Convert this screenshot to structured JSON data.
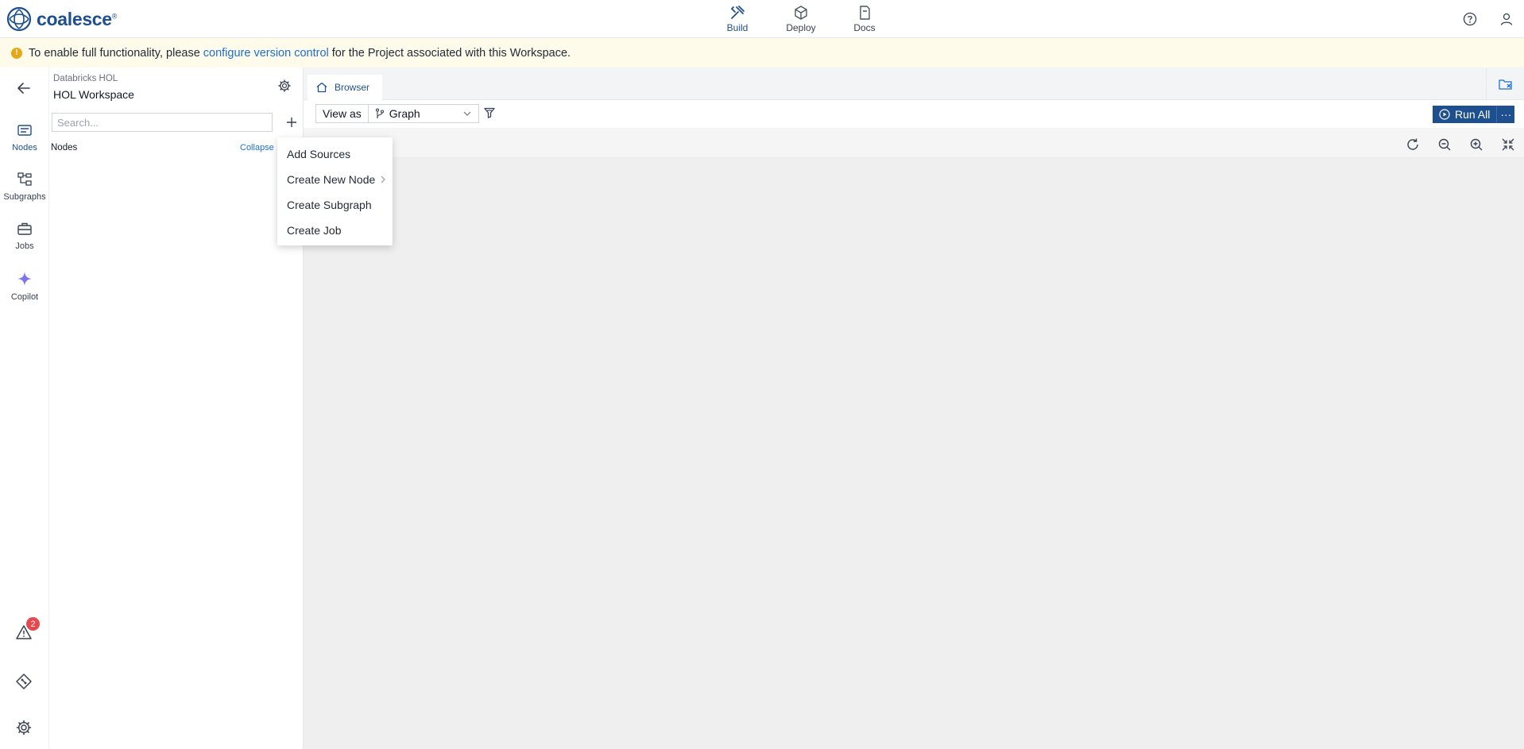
{
  "app": {
    "logo_text": "coalesce"
  },
  "nav": {
    "tabs": [
      {
        "label": "Build",
        "icon": "tools-icon",
        "active": true
      },
      {
        "label": "Deploy",
        "icon": "package-icon"
      },
      {
        "label": "Docs",
        "icon": "document-icon"
      }
    ]
  },
  "banner": {
    "prefix": "To enable full functionality, please",
    "link": "configure version control",
    "suffix": "for the Project associated with this Workspace."
  },
  "rail": {
    "items": [
      {
        "label": "Nodes",
        "icon": "nodes-icon",
        "active": true
      },
      {
        "label": "Subgraphs",
        "icon": "subgraph-icon"
      },
      {
        "label": "Jobs",
        "icon": "briefcase-icon"
      },
      {
        "label": "Copilot",
        "icon": "sparkle-icon"
      }
    ],
    "problems_count": "2"
  },
  "panel": {
    "project": "Databricks HOL",
    "workspace": "HOL Workspace",
    "search_placeholder": "Search...",
    "nodes_label": "Nodes",
    "collapse_label": "Collapse ."
  },
  "main": {
    "tab_label": "Browser",
    "view_as_label": "View as",
    "view_mode": "Graph",
    "run_all_label": "Run All",
    "more_label": "···"
  },
  "menu": {
    "items": [
      "Add Sources",
      "Create New Node",
      "Create Subgraph",
      "Create Job"
    ]
  },
  "colors": {
    "brand": "#1e4f8f",
    "link": "#1b6fd1",
    "banner_bg": "#fefbea",
    "badge": "#e5484d"
  }
}
